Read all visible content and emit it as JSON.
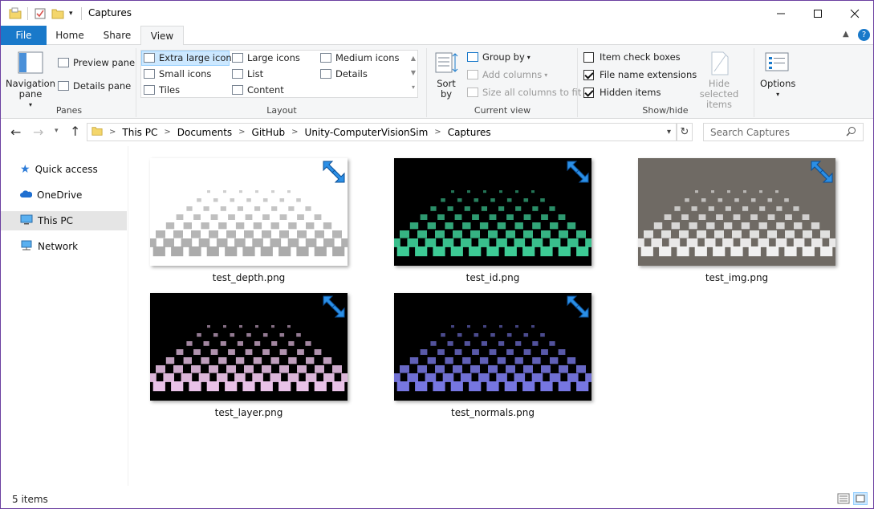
{
  "window": {
    "title": "Captures",
    "minimize_icon": "minimize-icon",
    "maximize_icon": "maximize-icon",
    "close_icon": "close-icon"
  },
  "ribbon_tabs": {
    "file": "File",
    "home": "Home",
    "share": "Share",
    "view": "View"
  },
  "ribbon": {
    "panes": {
      "navigation_pane": "Navigation pane",
      "preview_pane": "Preview pane",
      "details_pane": "Details pane",
      "group_label": "Panes"
    },
    "layout": {
      "items": [
        "Extra large icons",
        "Large icons",
        "Medium icons",
        "Small icons",
        "List",
        "Details",
        "Tiles",
        "Content"
      ],
      "selected": "Extra large icons",
      "group_label": "Layout"
    },
    "current_view": {
      "sort_by": "Sort by",
      "group_by": "Group by",
      "add_columns": "Add columns",
      "size_all_columns": "Size all columns to fit",
      "group_label": "Current view"
    },
    "show_hide": {
      "item_check_boxes": "Item check boxes",
      "file_name_extensions": "File name extensions",
      "hidden_items": "Hidden items",
      "hide_selected_items": "Hide selected items",
      "group_label": "Show/hide",
      "item_check_boxes_checked": false,
      "file_name_extensions_checked": true,
      "hidden_items_checked": true
    },
    "options": "Options"
  },
  "address": {
    "crumbs": [
      "This PC",
      "Documents",
      "GitHub",
      "Unity-ComputerVisionSim",
      "Captures"
    ]
  },
  "search": {
    "placeholder": "Search Captures"
  },
  "nav": {
    "items": [
      "Quick access",
      "OneDrive",
      "This PC",
      "Network"
    ],
    "selected": "This PC"
  },
  "files": [
    {
      "name": "test_depth.png",
      "bg": "#ffffff",
      "tile": "#a8a8a8"
    },
    {
      "name": "test_id.png",
      "bg": "#000000",
      "tile": "#3fd29a"
    },
    {
      "name": "test_img.png",
      "bg": "#6f6a64",
      "tile": "#f5f5f5"
    },
    {
      "name": "test_layer.png",
      "bg": "#000000",
      "tile": "#f1c8ef"
    },
    {
      "name": "test_normals.png",
      "bg": "#000000",
      "tile": "#7a7ae8"
    }
  ],
  "status": {
    "count": "5 items"
  },
  "colors": {
    "accent": "#1979ca",
    "selection": "#cce8ff"
  }
}
